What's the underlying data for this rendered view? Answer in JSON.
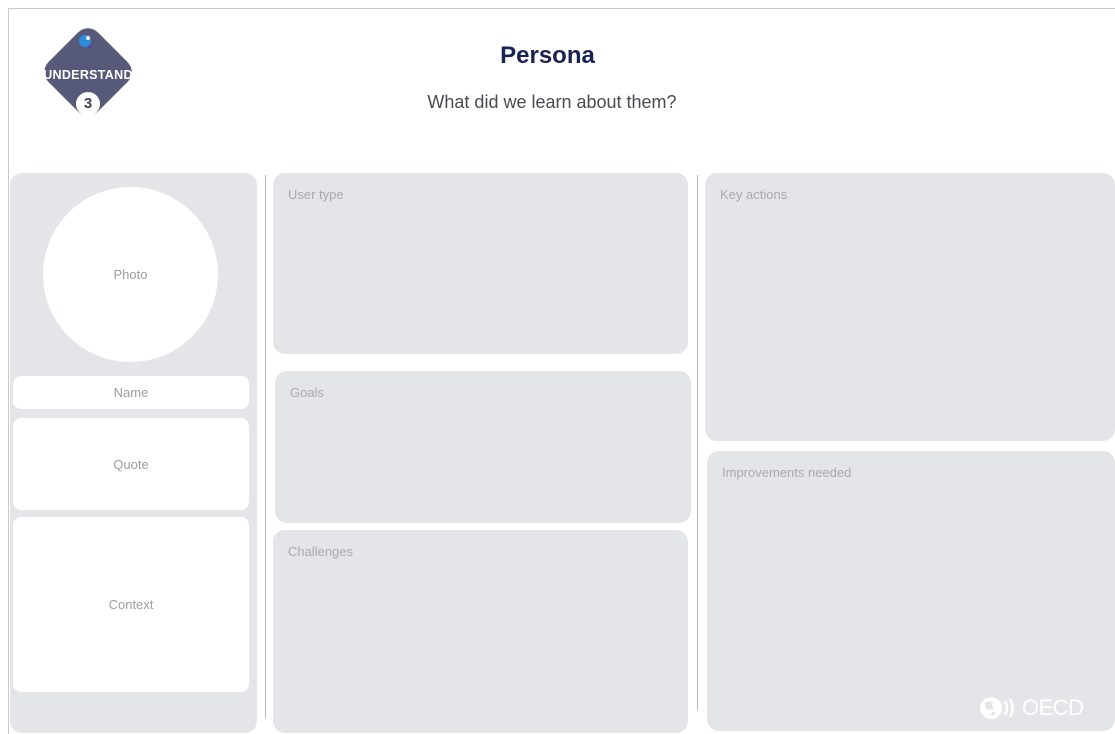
{
  "header": {
    "title": "Persona",
    "subtitle": "What did we learn about them?"
  },
  "badge": {
    "label": "UNDERSTAND",
    "number": "3",
    "icon": "lightbulb-dot-icon"
  },
  "profile": {
    "photo_label": "Photo",
    "name_label": "Name",
    "quote_label": "Quote",
    "context_label": "Context"
  },
  "middle": {
    "user_type_label": "User type",
    "goals_label": "Goals",
    "challenges_label": "Challenges"
  },
  "right": {
    "key_actions_label": "Key actions",
    "improvements_label": "Improvements needed"
  },
  "footer": {
    "logo_text": "OECD"
  },
  "colors": {
    "title": "#1b2352",
    "badge": "#565a78",
    "badge_dot": "#2a8bdf",
    "panel": "#e4e5e8"
  }
}
